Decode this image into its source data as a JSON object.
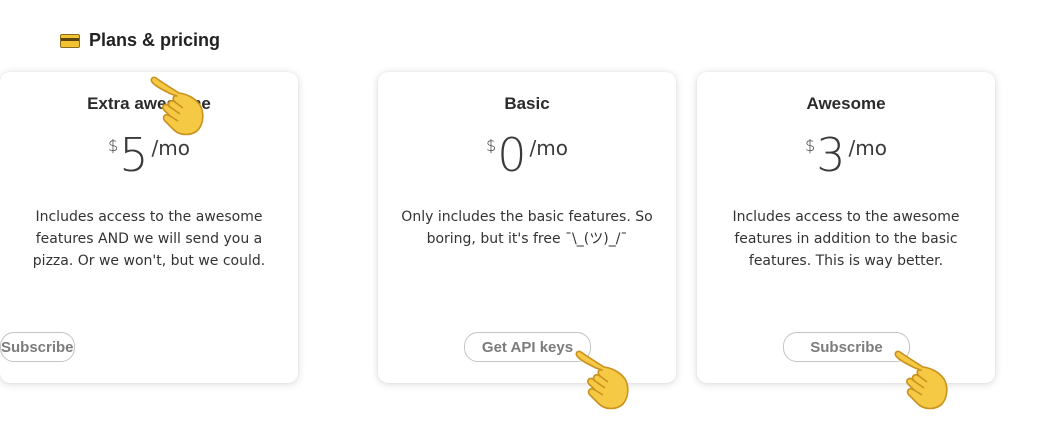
{
  "header": {
    "icon": "credit-card-icon",
    "title": "Plans & pricing"
  },
  "plans": [
    {
      "name": "Basic",
      "currency": "$",
      "amount": "0",
      "period": "/mo",
      "description": "Only includes the basic features. So boring, but it's free ¯\\_(ツ)_/¯",
      "button_label": "Get API keys"
    },
    {
      "name": "Awesome",
      "currency": "$",
      "amount": "3",
      "period": "/mo",
      "description": "Includes access to the awesome features in addition to the basic features. This is way better.",
      "button_label": "Subscribe"
    },
    {
      "name": "Extra awesome",
      "currency": "$",
      "amount": "5",
      "period": "/mo",
      "description": "Includes access to the awesome features AND we will send you a pizza. Or we won't, but we could.",
      "button_label": "Subscribe"
    }
  ],
  "decorations": {
    "pointer_icon": "pointing-hand-icon",
    "accent_color": "#f6c944"
  }
}
